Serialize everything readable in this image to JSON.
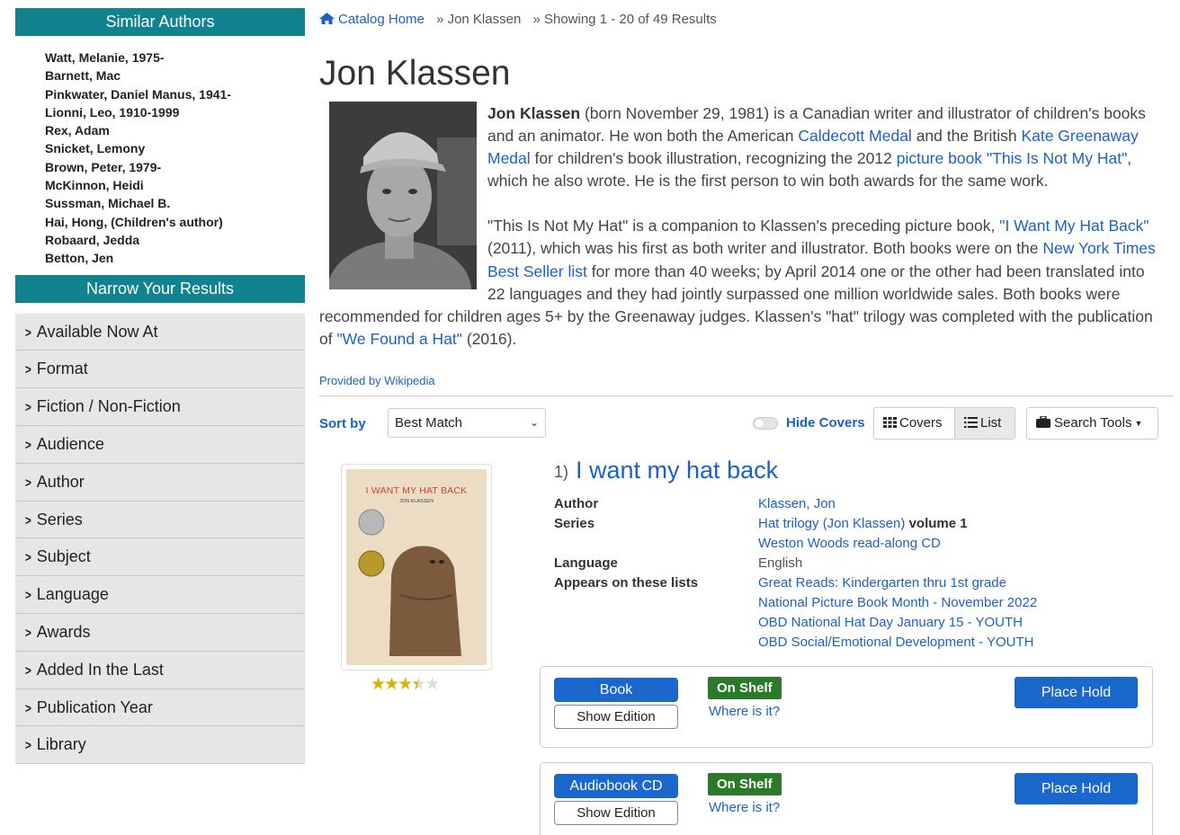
{
  "sidebar": {
    "similar_header": "Similar Authors",
    "similar_authors": [
      "Watt, Melanie, 1975-",
      "Barnett, Mac",
      "Pinkwater, Daniel Manus, 1941-",
      "Lionni, Leo, 1910-1999",
      "Rex, Adam",
      "Snicket, Lemony",
      "Brown, Peter, 1979-",
      "McKinnon, Heidi",
      "Sussman, Michael B.",
      "Hai, Hong, (Children's author)",
      "Robaard, Jedda",
      "Betton, Jen"
    ],
    "narrow_header": "Narrow Your Results",
    "facets": [
      "Available Now At",
      "Format",
      "Fiction / Non-Fiction",
      "Audience",
      "Author",
      "Series",
      "Subject",
      "Language",
      "Awards",
      "Added In the Last",
      "Publication Year",
      "Library"
    ]
  },
  "breadcrumb": {
    "home": "Catalog Home",
    "sep1": "»",
    "author": "Jon Klassen",
    "sep2": "»",
    "results": "Showing 1 - 20 of 49 Results"
  },
  "page_title": "Jon Klassen",
  "bio": {
    "name": "Jon Klassen",
    "p1_a": " (born November 29, 1981) is a Canadian writer and illustrator of children's books and an animator. He won both the American ",
    "link_caldecott": "Caldecott Medal",
    "p1_b": " and the British ",
    "link_greenaway": "Kate Greenaway Medal",
    "p1_c": " for children's book illustration, recognizing the 2012 ",
    "link_picturebook": "picture book",
    "p1_d": " ",
    "link_notmyhat": "\"This Is Not My Hat\"",
    "p1_e": ", which he also wrote. He is the first person to win both awards for the same work.",
    "p2_a": "\"This Is Not My Hat\" is a companion to Klassen's preceding picture book, ",
    "link_iwant": "\"I Want My Hat Back\"",
    "p2_b": " (2011), which was his first as both writer and illustrator. Both books were on the ",
    "link_nyt": "New York Times Best Seller list",
    "p2_c": " for more than 40 weeks; by April 2014 one or the other had been translated into 22 languages and they had jointly surpassed one million worldwide sales. Both books were recommended for children ages 5+ by the Greenaway judges. Klassen's \"hat\" trilogy was completed with the publication of ",
    "link_wefound": "\"We Found a Hat\"",
    "p2_d": " (2016).",
    "provided": "Provided by Wikipedia"
  },
  "toolbar": {
    "sort_label": "Sort by",
    "sort_value": "Best Match",
    "hide_covers": "Hide Covers",
    "covers": "Covers",
    "list": "List",
    "search_tools": "Search Tools"
  },
  "result": {
    "number": "1)",
    "title": "I want my hat back",
    "cover_title": "I WANT MY HAT BACK",
    "cover_author": "JON KLASSEN",
    "rating": 3.5,
    "rating_max": 5,
    "labels": {
      "author": "Author",
      "series": "Series",
      "language": "Language",
      "lists": "Appears on these lists"
    },
    "author": "Klassen, Jon",
    "series_link": "Hat trilogy (Jon Klassen)",
    "series_volume": "volume 1",
    "series2": "Weston Woods read-along CD",
    "language": "English",
    "lists": [
      "Great Reads: Kindergarten thru 1st grade",
      "National Picture Book Month - November 2022",
      "OBD National Hat Day January 15 - YOUTH",
      "OBD Social/Emotional Development - YOUTH"
    ],
    "holdings": [
      {
        "format": "Book",
        "edition": "Show Edition",
        "status": "On Shelf",
        "where": "Where is it?",
        "hold": "Place Hold"
      },
      {
        "format": "Audiobook CD",
        "edition": "Show Edition",
        "status": "On Shelf",
        "where": "Where is it?",
        "hold": "Place Hold"
      }
    ]
  },
  "colors": {
    "accent": "#11838f",
    "link": "#1a63c6",
    "button": "#1a68cc",
    "status": "#2a7a2a"
  }
}
